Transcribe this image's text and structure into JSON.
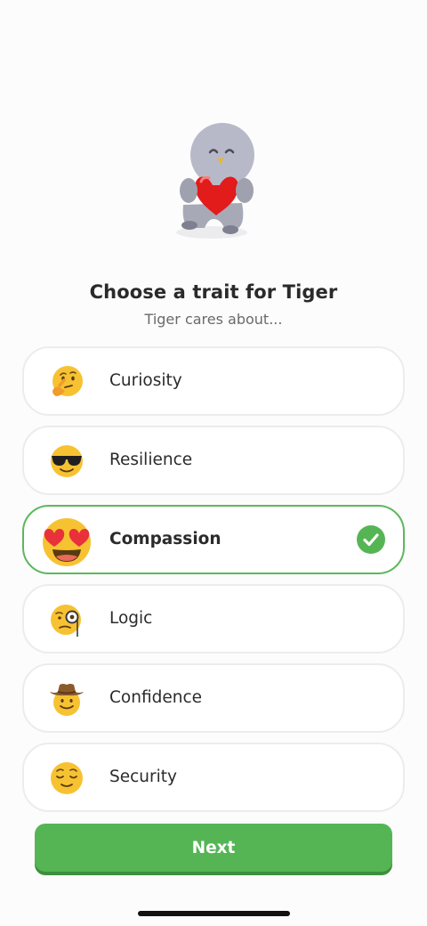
{
  "header": {
    "title": "Choose a trait for Tiger",
    "subtitle": "Tiger cares about..."
  },
  "mascot": {
    "icon": "bird-holding-heart-icon"
  },
  "options": [
    {
      "label": "Curiosity",
      "icon": "thinking-face-icon",
      "selected": false
    },
    {
      "label": "Resilience",
      "icon": "sunglasses-face-icon",
      "selected": false
    },
    {
      "label": "Compassion",
      "icon": "heart-eyes-face-icon",
      "selected": true
    },
    {
      "label": "Logic",
      "icon": "monocle-face-icon",
      "selected": false
    },
    {
      "label": "Confidence",
      "icon": "cowboy-face-icon",
      "selected": false
    },
    {
      "label": "Security",
      "icon": "relieved-face-icon",
      "selected": false
    }
  ],
  "footer": {
    "next_label": "Next"
  },
  "colors": {
    "accent": "#55b555",
    "selected_border": "#5cb85c",
    "card_border": "#ececee"
  }
}
